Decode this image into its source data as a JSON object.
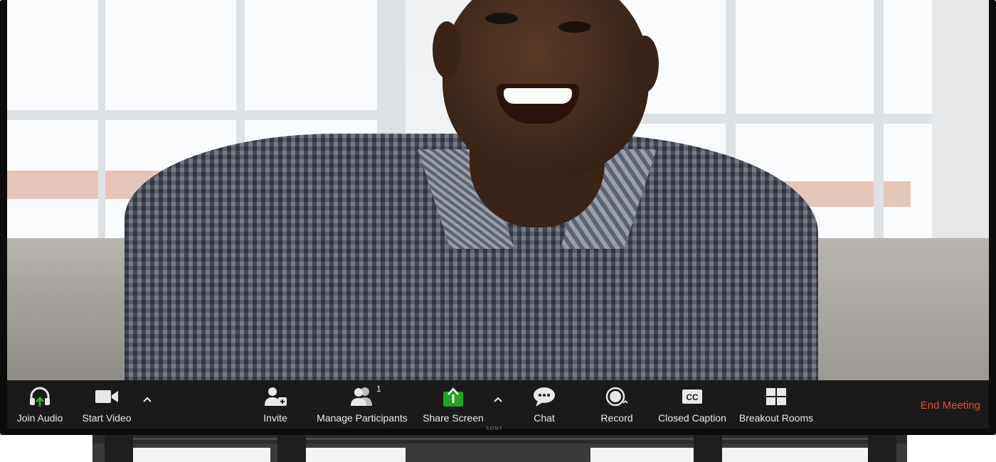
{
  "toolbar": {
    "join_audio": "Join Audio",
    "start_video": "Start Video",
    "invite": "Invite",
    "manage_participants": "Manage Participants",
    "participant_count": "1",
    "share_screen": "Share Screen",
    "chat": "Chat",
    "record": "Record",
    "closed_caption": "Closed Caption",
    "cc_glyph": "CC",
    "breakout_rooms": "Breakout Rooms",
    "end_meeting": "End Meeting"
  },
  "device": {
    "brand": "SONY"
  },
  "colors": {
    "toolbar_bg": "#1a1a1a",
    "share_green": "#20a520",
    "audio_arrow_green": "#2fbf2f",
    "end_meeting_red": "#e84a3a"
  },
  "icons": [
    "headphones-icon",
    "video-camera-icon",
    "caret-up-icon",
    "add-user-icon",
    "participants-icon",
    "share-screen-icon",
    "chat-bubble-icon",
    "record-icon",
    "closed-caption-icon",
    "breakout-rooms-icon"
  ]
}
